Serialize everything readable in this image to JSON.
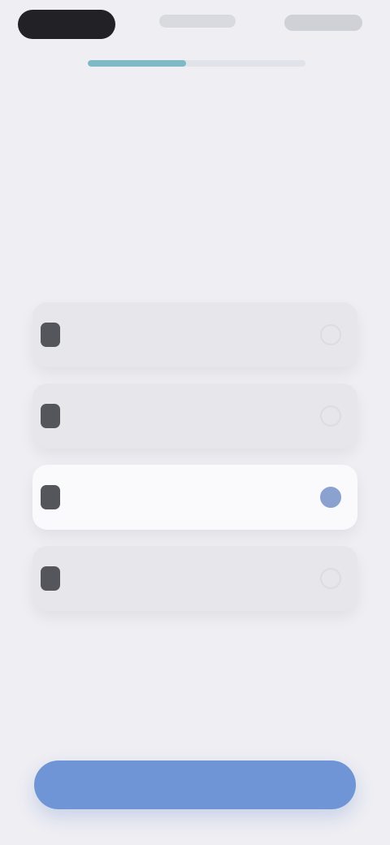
{
  "progress": {
    "fraction": 0.45
  },
  "colors": {
    "background": "#eeeef3",
    "accent": "#6f95d6",
    "progress": "#7fb9c7",
    "selected_indicator": "#8ba2d0"
  },
  "header": {
    "title": "",
    "subtitle": ""
  },
  "options": [
    {
      "label": "",
      "icon": "option-icon",
      "selected": false
    },
    {
      "label": "",
      "icon": "option-icon",
      "selected": false
    },
    {
      "label": "",
      "icon": "option-icon",
      "selected": true
    },
    {
      "label": "",
      "icon": "option-icon",
      "selected": false
    }
  ],
  "footer": {
    "continue_label": ""
  }
}
